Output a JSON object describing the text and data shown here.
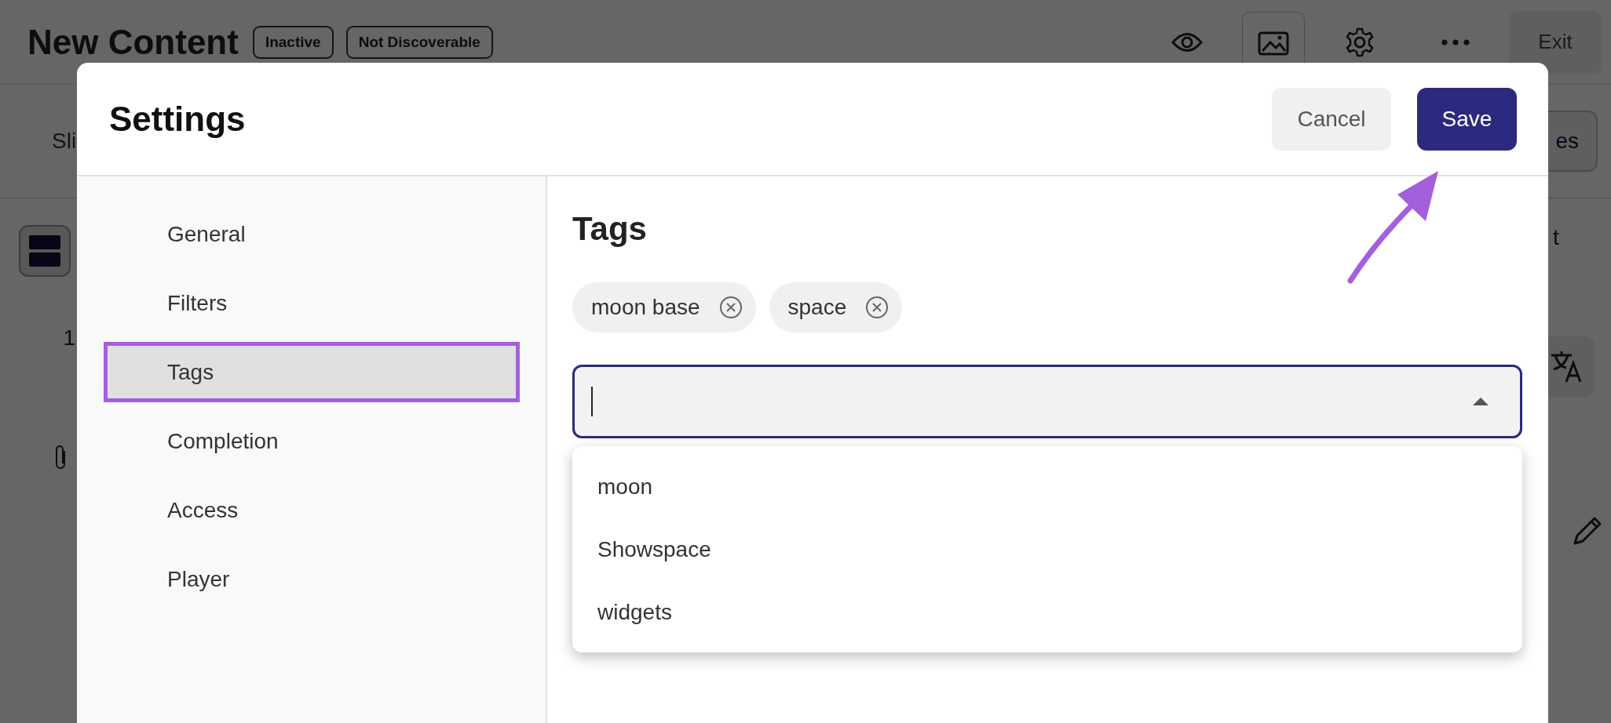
{
  "page": {
    "title": "New Content",
    "badges": [
      "Inactive",
      "Not Discoverable"
    ],
    "exit_button": "Exit",
    "tab_partial": "Sli",
    "button_partial": "es",
    "column_partial": "t",
    "row_number": "1"
  },
  "dialog": {
    "title": "Settings",
    "cancel_button": "Cancel",
    "save_button": "Save",
    "nav": [
      {
        "label": "General",
        "selected": false
      },
      {
        "label": "Filters",
        "selected": false
      },
      {
        "label": "Tags",
        "selected": true
      },
      {
        "label": "Completion",
        "selected": false
      },
      {
        "label": "Access",
        "selected": false
      },
      {
        "label": "Player",
        "selected": false
      }
    ],
    "section_title": "Tags",
    "tags": [
      "moon base",
      "space"
    ],
    "tag_input": {
      "expanded": true
    },
    "options": [
      "moon",
      "Showspace",
      "widgets"
    ]
  }
}
